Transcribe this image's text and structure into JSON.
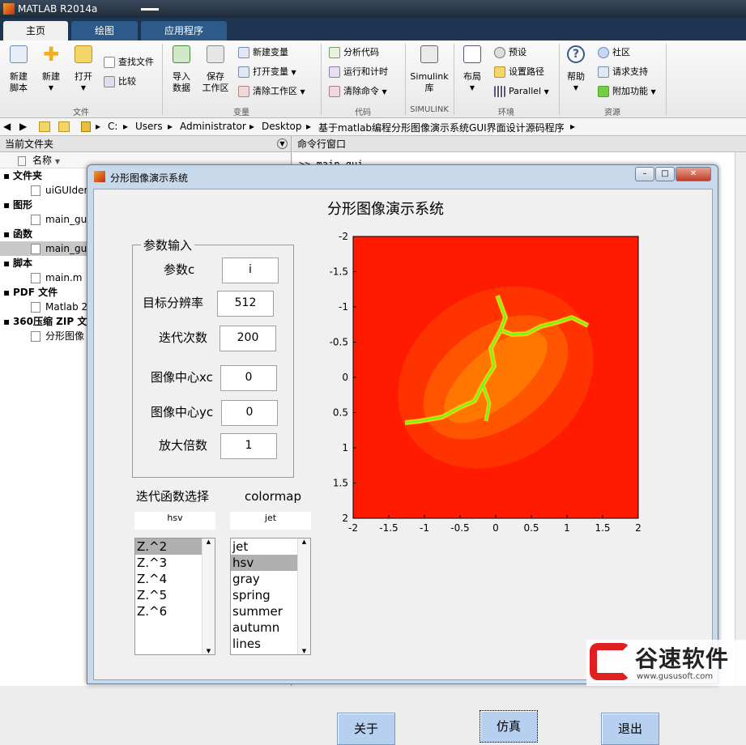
{
  "app": {
    "title": "MATLAB R2014a"
  },
  "tabs": [
    "主页",
    "绘图",
    "应用程序"
  ],
  "ribbon": {
    "file": {
      "new_script": "新建\n脚本",
      "new": "新建",
      "open": "打开",
      "find_files": "查找文件",
      "compare": "比较",
      "group": "文件"
    },
    "variable": {
      "import": "导入\n数据",
      "save": "保存\n工作区",
      "new_var": "新建变量",
      "open_var": "打开变量",
      "clear_ws": "清除工作区",
      "group": "变量"
    },
    "code": {
      "analyze": "分析代码",
      "run_time": "运行和计时",
      "clear_cmd": "清除命令",
      "group": "代码"
    },
    "simulink": {
      "lib": "Simulink\n库",
      "group": "SIMULINK"
    },
    "env": {
      "layout": "布局",
      "prefs": "预设",
      "set_path": "设置路径",
      "parallel": "Parallel",
      "group": "环境"
    },
    "resources": {
      "help": "帮助",
      "community": "社区",
      "support": "请求支持",
      "addons": "附加功能",
      "group": "资源"
    }
  },
  "address": {
    "crumbs": [
      "C:",
      "Users",
      "Administrator",
      "Desktop",
      "基于matlab编程分形图像演示系统GUI界面设计源码程序"
    ]
  },
  "left_panel": {
    "title": "当前文件夹",
    "col_name": "名称",
    "tree": [
      {
        "label": "文件夹",
        "bold": true
      },
      {
        "label": "uiGUIden",
        "bold": false
      },
      {
        "label": "图形",
        "bold": true
      },
      {
        "label": "main_gui",
        "bold": false
      },
      {
        "label": "函数",
        "bold": true
      },
      {
        "label": "main_gui",
        "bold": false
      },
      {
        "label": "脚本",
        "bold": true
      },
      {
        "label": "main.m",
        "bold": false
      },
      {
        "label": "PDF 文件",
        "bold": true
      },
      {
        "label": "Matlab 2",
        "bold": false
      },
      {
        "label": "360压缩 ZIP 文",
        "bold": true
      },
      {
        "label": "分形图像",
        "bold": false
      }
    ]
  },
  "cmd_panel": {
    "title": "命令行窗口",
    "prompt": ">> main_gui"
  },
  "figure": {
    "title": "分形图像演示系统",
    "heading": "分形图像演示系统",
    "params_group": "参数输入",
    "params": [
      {
        "label": "参数c",
        "value": "i"
      },
      {
        "label": "目标分辨率",
        "value": "512"
      },
      {
        "label": "迭代次数",
        "value": "200"
      },
      {
        "label": "图像中心xc",
        "value": "0"
      },
      {
        "label": "图像中心yc",
        "value": "0"
      },
      {
        "label": "放大倍数",
        "value": "1"
      }
    ],
    "iter_label": "迭代函数选择",
    "colormap_label": "colormap",
    "iter_selected": "hsv",
    "colormap_selected": "jet",
    "iter_list": [
      "Z.^2",
      "Z.^3",
      "Z.^4",
      "Z.^5",
      "Z.^6"
    ],
    "iter_list_sel": 0,
    "cmap_list": [
      "jet",
      "hsv",
      "gray",
      "spring",
      "summer",
      "autumn",
      "lines"
    ],
    "cmap_list_sel": 1,
    "buttons": {
      "about": "关于",
      "simulate": "仿真",
      "exit": "退出"
    },
    "x_ticks": [
      "-2",
      "-1.5",
      "-1",
      "-0.5",
      "0",
      "0.5",
      "1",
      "1.5",
      "2"
    ],
    "y_ticks": [
      "-2",
      "-1.5",
      "-1",
      "-0.5",
      "0",
      "0.5",
      "1",
      "1.5",
      "2"
    ]
  },
  "watermark": {
    "text": "谷速软件",
    "url": "www.gususoft.com"
  }
}
